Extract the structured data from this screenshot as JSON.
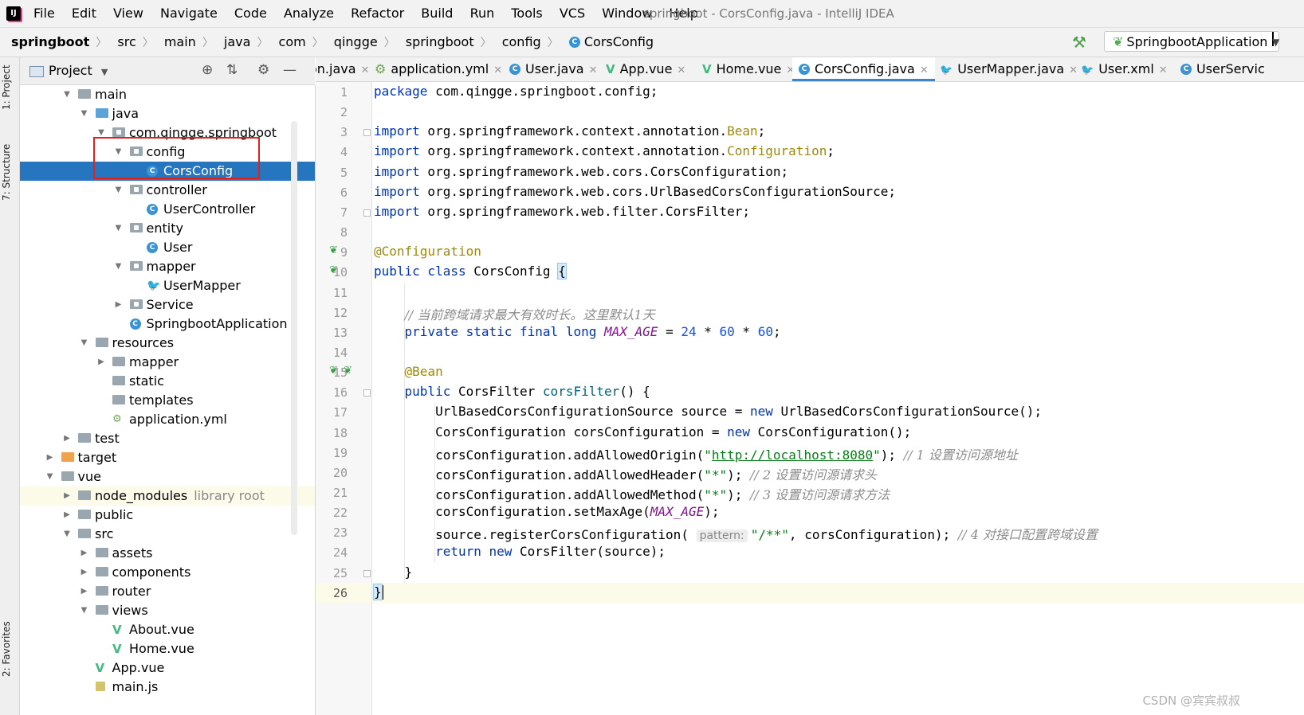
{
  "menubar": {
    "logo": "IJ",
    "items": [
      "File",
      "Edit",
      "View",
      "Navigate",
      "Code",
      "Analyze",
      "Refactor",
      "Build",
      "Run",
      "Tools",
      "VCS",
      "Window",
      "Help"
    ],
    "window_title": "springboot - CorsConfig.java - IntelliJ IDEA"
  },
  "breadcrumbs": [
    "springboot",
    "src",
    "main",
    "java",
    "com",
    "qingge",
    "springboot",
    "config",
    "CorsConfig"
  ],
  "run_config": "SpringbootApplication",
  "left_toolwindows": [
    "1: Project",
    "7: Structure",
    "2: Favorites"
  ],
  "project_panel": {
    "title": "Project"
  },
  "tree": [
    {
      "label": "main",
      "type": "folder",
      "depth": 2,
      "expanded": true
    },
    {
      "label": "java",
      "type": "folder-blue",
      "depth": 3,
      "expanded": true
    },
    {
      "label": "com.qingge.springboot",
      "type": "package",
      "depth": 4,
      "expanded": true
    },
    {
      "label": "config",
      "type": "package",
      "depth": 5,
      "expanded": true
    },
    {
      "label": "CorsConfig",
      "type": "class",
      "depth": 6,
      "selected": true
    },
    {
      "label": "controller",
      "type": "package",
      "depth": 5,
      "expanded": true
    },
    {
      "label": "UserController",
      "type": "class",
      "depth": 6
    },
    {
      "label": "entity",
      "type": "package",
      "depth": 5,
      "expanded": true
    },
    {
      "label": "User",
      "type": "class",
      "depth": 6
    },
    {
      "label": "mapper",
      "type": "package",
      "depth": 5,
      "expanded": true
    },
    {
      "label": "UserMapper",
      "type": "mapper",
      "depth": 6
    },
    {
      "label": "Service",
      "type": "package",
      "depth": 5,
      "expanded": false
    },
    {
      "label": "SpringbootApplication",
      "type": "springclass",
      "depth": 5
    },
    {
      "label": "resources",
      "type": "folder-res",
      "depth": 3,
      "expanded": true
    },
    {
      "label": "mapper",
      "type": "folder",
      "depth": 4,
      "expanded": false
    },
    {
      "label": "static",
      "type": "folder",
      "depth": 4
    },
    {
      "label": "templates",
      "type": "folder",
      "depth": 4
    },
    {
      "label": "application.yml",
      "type": "yml",
      "depth": 4
    },
    {
      "label": "test",
      "type": "folder",
      "depth": 2,
      "expanded": false
    },
    {
      "label": "target",
      "type": "folder-orange",
      "depth": 1,
      "expanded": false
    },
    {
      "label": "vue",
      "type": "folder",
      "depth": 1,
      "expanded": true
    },
    {
      "label": "node_modules",
      "type": "folder",
      "depth": 2,
      "expanded": false,
      "extra": "library root",
      "highlight": true
    },
    {
      "label": "public",
      "type": "folder",
      "depth": 2,
      "expanded": false
    },
    {
      "label": "src",
      "type": "folder",
      "depth": 2,
      "expanded": true
    },
    {
      "label": "assets",
      "type": "folder",
      "depth": 3,
      "expanded": false
    },
    {
      "label": "components",
      "type": "folder",
      "depth": 3,
      "expanded": false
    },
    {
      "label": "router",
      "type": "folder",
      "depth": 3,
      "expanded": false
    },
    {
      "label": "views",
      "type": "folder",
      "depth": 3,
      "expanded": true
    },
    {
      "label": "About.vue",
      "type": "vue",
      "depth": 4
    },
    {
      "label": "Home.vue",
      "type": "vue",
      "depth": 4
    },
    {
      "label": "App.vue",
      "type": "vue",
      "depth": 3
    },
    {
      "label": "main.js",
      "type": "js",
      "depth": 3
    }
  ],
  "tabs": [
    {
      "label": "on.java",
      "icon": "none"
    },
    {
      "label": "application.yml",
      "icon": "yml"
    },
    {
      "label": "User.java",
      "icon": "class"
    },
    {
      "label": "App.vue",
      "icon": "vue"
    },
    {
      "label": "Home.vue",
      "icon": "vue"
    },
    {
      "label": "CorsConfig.java",
      "icon": "class",
      "active": true
    },
    {
      "label": "UserMapper.java",
      "icon": "mapper"
    },
    {
      "label": "User.xml",
      "icon": "mapper"
    },
    {
      "label": "UserServic",
      "icon": "class"
    }
  ],
  "current_line": 26,
  "code_lines": [
    "package com.qingge.springboot.config;",
    "",
    "import org.springframework.context.annotation.Bean;",
    "import org.springframework.context.annotation.Configuration;",
    "import org.springframework.web.cors.CorsConfiguration;",
    "import org.springframework.web.cors.UrlBasedCorsConfigurationSource;",
    "import org.springframework.web.filter.CorsFilter;",
    "",
    "@Configuration",
    "public class CorsConfig {",
    "",
    "    // 当前跨域请求最大有效时长。这里默认1天",
    "    private static final long MAX_AGE = 24 * 60 * 60;",
    "",
    "    @Bean",
    "    public CorsFilter corsFilter() {",
    "        UrlBasedCorsConfigurationSource source = new UrlBasedCorsConfigurationSource();",
    "        CorsConfiguration corsConfiguration = new CorsConfiguration();",
    "        corsConfiguration.addAllowedOrigin(\"http://localhost:8080\"); // 1 设置访问源地址",
    "        corsConfiguration.addAllowedHeader(\"*\"); // 2 设置访问源请求头",
    "        corsConfiguration.addAllowedMethod(\"*\"); // 3 设置访问源请求方法",
    "        corsConfiguration.setMaxAge(MAX_AGE);",
    "        source.registerCorsConfiguration( pattern: \"/**\", corsConfiguration); // 4 对接口配置跨域设置",
    "        return new CorsFilter(source);",
    "    }",
    "}"
  ],
  "code_parts": {
    "l12_comment": "// 当前跨域请求最大有效时长。这里默认1天",
    "l19_call": "corsConfiguration.addAllowedOrigin(",
    "l19_url": "http://localhost:8080",
    "l19_comment": "// 1 设置访问源地址",
    "l20_call": "corsConfiguration.addAllowedHeader(",
    "l20_comment": "// 2 设置访问源请求头",
    "l21_call": "corsConfiguration.addAllowedMethod(",
    "l21_comment": "// 3 设置访问源请求方法",
    "l23_hint": "pattern:",
    "l23_comment": "// 4 对接口配置跨域设置"
  },
  "watermark": "CSDN @宾宾叔叔",
  "colors": {
    "selection": "#2675bf",
    "keyword": "#0033b3",
    "annotation": "#9e880d",
    "string": "#067d17",
    "comment": "#8c8c8c",
    "number": "#1750eb",
    "constant": "#871094",
    "highlight_box": "#e0201c"
  }
}
